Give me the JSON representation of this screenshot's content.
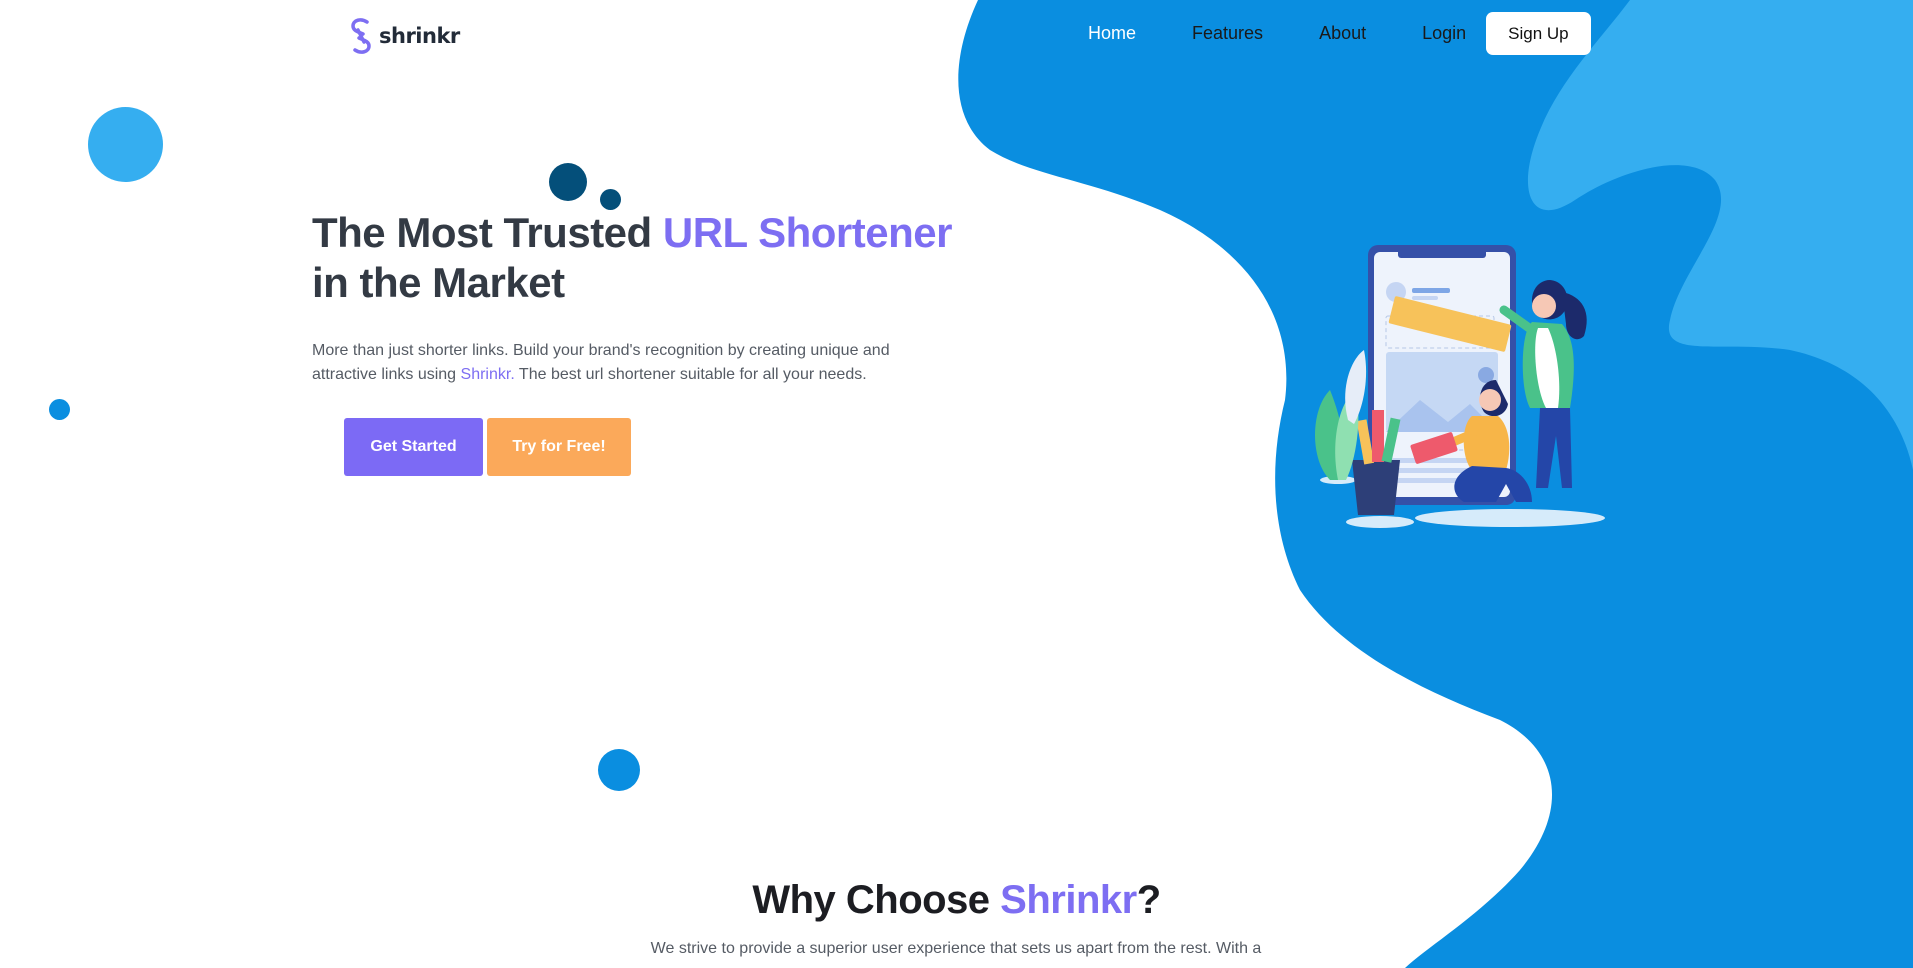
{
  "colors": {
    "brand_purple": "#7d6ef2",
    "blob_blue": "#0a8ee0",
    "light_blue": "#35aef0",
    "dark_teal": "#044f7a",
    "orange": "#fba95a"
  },
  "header": {
    "logo_text": "shrinkr",
    "logo_icon": "chain-link-icon",
    "nav": {
      "home": "Home",
      "features": "Features",
      "about": "About",
      "login": "Login",
      "signup": "Sign Up"
    }
  },
  "hero": {
    "title_part1": "The Most Trusted ",
    "title_accent": "URL Shortener",
    "title_part2": " in the Market",
    "desc_part1": "More than just shorter links. Build your brand's recognition by creating unique and attractive links using ",
    "desc_brand": "Shrinkr.",
    "desc_part2": " The best url shortener suitable for all your needs.",
    "primary_button": "Get Started",
    "secondary_button": "Try for Free!"
  },
  "why": {
    "title_part1": "Why Choose ",
    "title_accent": "Shrinkr",
    "title_part2": "?",
    "desc": "We strive to provide a superior user experience that sets us apart from the rest. With a"
  }
}
